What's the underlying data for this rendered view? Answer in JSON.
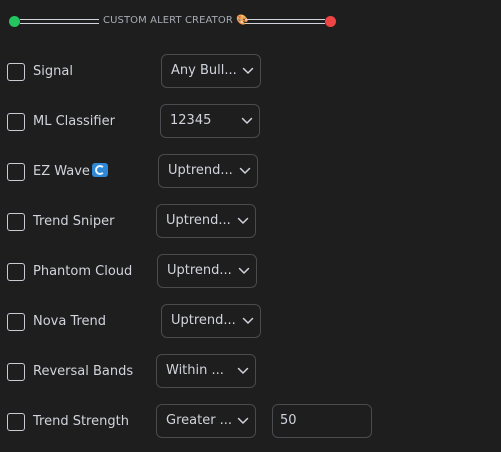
{
  "header": {
    "title": "CUSTOM ALERT CREATOR",
    "title_emoji": "🎨",
    "left_dot_color": "#22c55e",
    "right_dot_color": "#ef4444"
  },
  "rows": [
    {
      "label": "Signal",
      "checked": false,
      "select_value": "Any Bull..."
    },
    {
      "label": "ML Classifier",
      "checked": false,
      "select_value": "12345"
    },
    {
      "label": "EZ Wave",
      "label_icon": "wave-emoji",
      "checked": false,
      "select_value": "Uptrend..."
    },
    {
      "label": "Trend Sniper",
      "checked": false,
      "select_value": "Uptrend..."
    },
    {
      "label": "Phantom Cloud",
      "checked": false,
      "select_value": "Uptrend..."
    },
    {
      "label": "Nova Trend",
      "checked": false,
      "select_value": "Uptrend..."
    },
    {
      "label": "Reversal Bands",
      "checked": false,
      "select_value": "Within ..."
    },
    {
      "label": "Trend Strength",
      "checked": false,
      "select_value": "Greater ...",
      "input_value": "50"
    }
  ],
  "colors": {
    "background": "#1e1e1e",
    "text": "#d1d4dc",
    "border": "#4a4a4f"
  }
}
